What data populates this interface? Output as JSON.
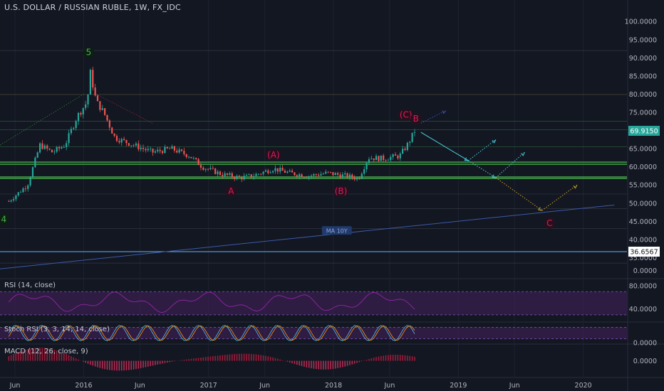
{
  "header": {
    "title": "U.S. DOLLAR / RUSSIAN RUBLE, 1W, FX_IDC"
  },
  "colors": {
    "background": "#131722",
    "up": "#26a69a",
    "down": "#ef5350",
    "wave": "#c2185b",
    "green_wave": "#2e7d32",
    "hline_green": "#43a047",
    "hline_olive": "#8a8a3a",
    "ma_line": "#2962ff",
    "rsi_fill": "#3a1f4f",
    "price_tag": "#26a69a",
    "blue_tag": "#1e88e5"
  },
  "chart_data": {
    "type": "candlestick",
    "title": "U.S. DOLLAR / RUSSIAN RUBLE, 1W, FX_IDC",
    "x_axis_labels": [
      "Jun",
      "2016",
      "Jun",
      "2017",
      "Jun",
      "2018",
      "Jun",
      "2019",
      "Jun",
      "2020"
    ],
    "y_axis": {
      "range": [
        30,
        102
      ],
      "ticks": [
        "100.0000",
        "95.0000",
        "90.0000",
        "85.0000",
        "80.0000",
        "75.0000",
        "70.0000",
        "65.0000",
        "60.0000",
        "55.0000",
        "50.0000",
        "45.0000",
        "40.0000",
        "35.0000"
      ]
    },
    "last_price": "69.9150",
    "support_price": "36.6567",
    "horizontal_levels": [
      79.9,
      72.6,
      70.2,
      65.5,
      61.3,
      60.7,
      57.2,
      56.8
    ],
    "price_path": [
      [
        2015.4,
        50.5
      ],
      [
        2015.55,
        55
      ],
      [
        2015.65,
        66
      ],
      [
        2015.75,
        64
      ],
      [
        2015.85,
        66
      ],
      [
        2015.95,
        74
      ],
      [
        2016.03,
        78
      ],
      [
        2016.05,
        86.5
      ],
      [
        2016.1,
        78
      ],
      [
        2016.16,
        75
      ],
      [
        2016.25,
        68
      ],
      [
        2016.4,
        66
      ],
      [
        2016.55,
        64
      ],
      [
        2016.7,
        65
      ],
      [
        2016.85,
        63
      ],
      [
        2016.95,
        60
      ],
      [
        2017.1,
        58
      ],
      [
        2017.25,
        57
      ],
      [
        2017.35,
        57.5
      ],
      [
        2017.52,
        59.5
      ],
      [
        2017.65,
        58.3
      ],
      [
        2017.8,
        57.5
      ],
      [
        2017.95,
        58.3
      ],
      [
        2018.1,
        57.5
      ],
      [
        2018.2,
        56.8
      ],
      [
        2018.28,
        62.5
      ],
      [
        2018.4,
        62.3
      ],
      [
        2018.53,
        63.0
      ],
      [
        2018.6,
        66.5
      ],
      [
        2018.65,
        69.9
      ]
    ],
    "wave_labels": [
      {
        "text": "5",
        "x": 2016.04,
        "y": 91.5,
        "style": "green"
      },
      {
        "text": "4",
        "x": 2015.36,
        "y": 45.6,
        "style": "green"
      },
      {
        "text": "A",
        "x": 2017.18,
        "y": 53.3,
        "style": "wave"
      },
      {
        "text": "(A)",
        "x": 2017.52,
        "y": 63.3,
        "style": "wave"
      },
      {
        "text": "(B)",
        "x": 2018.06,
        "y": 53.3,
        "style": "wave"
      },
      {
        "text": "(C)",
        "x": 2018.58,
        "y": 74.3,
        "style": "wave"
      },
      {
        "text": "B",
        "x": 2018.66,
        "y": 73.2,
        "style": "wave"
      },
      {
        "text": "C",
        "x": 2019.73,
        "y": 44.5,
        "style": "wave"
      }
    ],
    "ma_label": "MA 10Y",
    "ma_line": {
      "from": [
        2015.3,
        31.8
      ],
      "to": [
        2020.25,
        49.5
      ]
    },
    "projection": {
      "solid": [
        [
          2018.7,
          69.5
        ],
        [
          2019.08,
          61.7
        ]
      ],
      "dotted_up_1": [
        [
          2019.08,
          61.7
        ],
        [
          2019.3,
          67.5
        ]
      ],
      "dotted_dn_1": [
        [
          2019.08,
          61.7
        ],
        [
          2019.3,
          57
        ]
      ],
      "dotted_up_2": [
        [
          2019.3,
          57
        ],
        [
          2019.53,
          64
        ]
      ],
      "dotted_dn_2": [
        [
          2019.3,
          57
        ],
        [
          2019.67,
          48
        ]
      ],
      "dotted_up_3": [
        [
          2019.67,
          48
        ],
        [
          2019.95,
          55
        ]
      ],
      "blue_up": [
        [
          2018.7,
          72
        ],
        [
          2018.9,
          75.5
        ]
      ]
    },
    "oscillators": [
      {
        "name": "RSI (14, close)",
        "ticks": [
          "80.0000",
          "40.0000"
        ],
        "range": [
          20,
          90
        ],
        "band": [
          30,
          70
        ]
      },
      {
        "name": "Stoch RSI (3, 3, 14, 14, close)",
        "ticks": [
          "0.0000"
        ],
        "range": [
          0,
          100
        ],
        "band": [
          20,
          80
        ]
      },
      {
        "name": "MACD (12, 26, close, 9)",
        "ticks": [
          "0.0000"
        ],
        "range": [
          -6,
          6
        ]
      }
    ],
    "right_axis_zero": "0.0000"
  }
}
